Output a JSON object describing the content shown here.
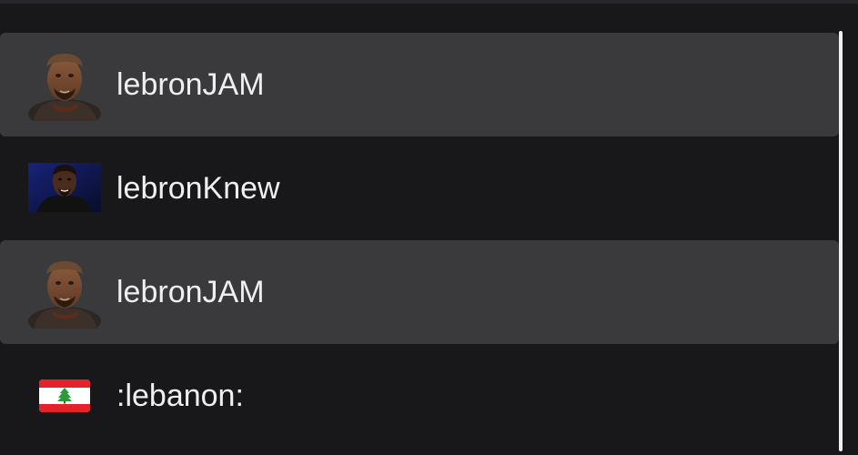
{
  "suggestions": [
    {
      "name": "lebronJAM",
      "icon": "lebron-jam-emote-icon",
      "highlighted": true
    },
    {
      "name": "lebronKnew",
      "icon": "lebron-knew-emote-icon",
      "highlighted": false
    },
    {
      "name": "lebronJAM",
      "icon": "lebron-jam-emote-icon",
      "highlighted": true
    },
    {
      "name": ":lebanon:",
      "icon": "lebanon-flag-icon",
      "highlighted": false
    }
  ],
  "colors": {
    "background": "#18181b",
    "highlight": "#3a3a3d",
    "text": "#efeff1",
    "flag_red": "#e3222a",
    "flag_green": "#2b9b3a"
  }
}
